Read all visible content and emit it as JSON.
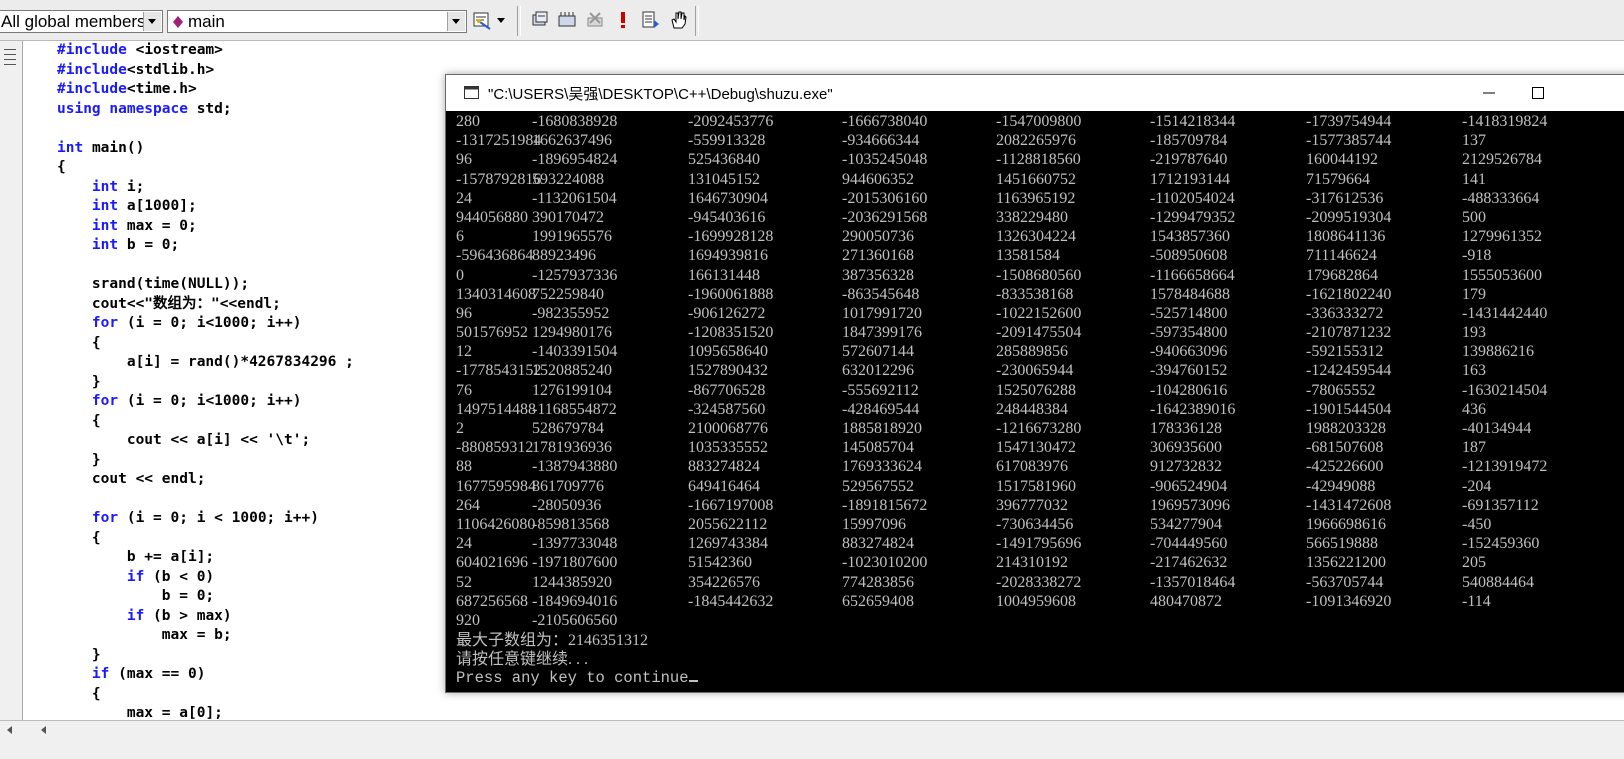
{
  "toolbar": {
    "members_combo": "All global members",
    "function_combo": "main",
    "icons": [
      "diamond-icon",
      "wizard-icon",
      "dropdown-arrow-icon",
      "compile-icon",
      "build-icon",
      "stop-build-icon",
      "execute-icon",
      "go-icon",
      "breakpoint-hand-icon"
    ]
  },
  "editor": {
    "lines": [
      "#include <iostream>",
      "#include<stdlib.h>",
      "#include<time.h>",
      "using namespace std;",
      "",
      "int main()",
      "{",
      "    int i;",
      "    int a[1000];",
      "    int max = 0;",
      "    int b = 0;",
      "",
      "    srand(time(NULL));",
      "    cout<<\"数组为：\"<<endl;",
      "    for (i = 0; i<1000; i++)",
      "    {",
      "        a[i] = rand()*4267834296 ;",
      "    }",
      "    for (i = 0; i<1000; i++)",
      "    {",
      "        cout << a[i] << '\\t';",
      "    }",
      "    cout << endl;",
      "",
      "    for (i = 0; i < 1000; i++)",
      "    {",
      "        b += a[i];",
      "        if (b < 0)",
      "            b = 0;",
      "        if (b > max)",
      "            max = b;",
      "    }",
      "    if (max == 0)",
      "    {",
      "        max = a[0];"
    ],
    "keywords": [
      "#include",
      "using",
      "namespace",
      "int",
      "for",
      "if"
    ]
  },
  "console": {
    "title": "\"C:\\USERS\\吴强\\DESKTOP\\C++\\Debug\\shuzu.exe\"",
    "rows": [
      [
        "280",
        "-1680838928",
        "-2092453776",
        "-1666738040",
        "-1547009800",
        "-1514218344",
        "-1739754944",
        "-1418319824"
      ],
      [
        "-1317251984",
        "1662637496",
        "-559913328",
        "-934666344",
        "2082265976",
        "-185709784",
        "-1577385744",
        "137"
      ],
      [
        "96",
        "-1896954824",
        "525436840",
        "-1035245048",
        "-1128818560",
        "-219787640",
        "160044192",
        "2129526784"
      ],
      [
        "-1578792816",
        "593224088",
        "131045152",
        "944606352",
        "1451660752",
        "1712193144",
        "71579664",
        "141"
      ],
      [
        "24",
        "-1132061504",
        "1646730904",
        "-2015306160",
        "1163965192",
        "-1102054024",
        "-317612536",
        "-488333664"
      ],
      [
        "944056880",
        "390170472",
        "-945403616",
        "-2036291568",
        "338229480",
        "-1299479352",
        "-2099519304",
        "500"
      ],
      [
        "6",
        "1991965576",
        "-1699928128",
        "290050736",
        "1326304224",
        "1543857360",
        "1808641136",
        "1279961352"
      ],
      [
        "-596436864",
        "88923496",
        "1694939816",
        "271360168",
        "13581584",
        "-508950608",
        "711146624",
        "-918"
      ],
      [
        "0",
        "-1257937336",
        "166131448",
        "387356328",
        "-1508680560",
        "-1166658664",
        "179682864",
        "1555053600"
      ],
      [
        "1340314608",
        "752259840",
        "-1960061888",
        "-863545648",
        "-833538168",
        "1578484688",
        "-1621802240",
        "179"
      ],
      [
        "96",
        "-982355952",
        "-906126272",
        "1017991720",
        "-1022152600",
        "-525714800",
        "-336333272",
        "-1431442440"
      ],
      [
        "501576952",
        "1294980176",
        "-1208351520",
        "1847399176",
        "-2091475504",
        "-597354800",
        "-2107871232",
        "193"
      ],
      [
        "12",
        "-1403391504",
        "1095658640",
        "572607144",
        "285889856",
        "-940663096",
        "-592155312",
        "139886216"
      ],
      [
        "-1778543152",
        "1520885240",
        "1527890432",
        "632012296",
        "-230065944",
        "-394760152",
        "-1242459544",
        "163"
      ],
      [
        "76",
        "1276199104",
        "-867706528",
        "-555692112",
        "1525076288",
        "-104280616",
        "-78065552",
        "-1630214504"
      ],
      [
        "1497514488",
        "-1168554872",
        "-324587560",
        "-428469544",
        "248448384",
        "-1642389016",
        "-1901544504",
        "436"
      ],
      [
        "2",
        "528679784",
        "2100068776",
        "1885818920",
        "-1216673280",
        "178336128",
        "1988203328",
        "-40134944"
      ],
      [
        "-880859312",
        "1781936936",
        "1035335552",
        "145085704",
        "1547130472",
        "306935600",
        "-681507608",
        "187"
      ],
      [
        "88",
        "-1387943880",
        "883274824",
        "1769333624",
        "617083976",
        "912732832",
        "-425226600",
        "-1213919472"
      ],
      [
        "1677595984",
        "861709776",
        "649416464",
        "529567552",
        "1517581960",
        "-906524904",
        "-42949088",
        "-204"
      ],
      [
        "264",
        "-28050936",
        "-1667197008",
        "-1891815672",
        "396777032",
        "1969573096",
        "-1431472608",
        "-691357112"
      ],
      [
        "1106426080",
        "-859813568",
        "2055622112",
        "15997096",
        "-730634456",
        "534277904",
        "1966698616",
        "-450"
      ],
      [
        "24",
        "-1397733048",
        "1269743384",
        "883274824",
        "-1491795696",
        "-704449560",
        "566519888",
        "-152459360"
      ],
      [
        "604021696",
        "-1971807600",
        "51542360",
        "-1023010200",
        "214310192",
        "-217462632",
        "1356221200",
        "205"
      ],
      [
        "52",
        "1244385920",
        "354226576",
        "774283856",
        "-2028338272",
        "-1357018464",
        "-563705744",
        "540884464"
      ],
      [
        "687256568",
        "-1849694016",
        "-1845442632",
        "652659408",
        "1004959608",
        "480470872",
        "-1091346920",
        "-114"
      ],
      [
        "920",
        "-2105606560"
      ]
    ],
    "result_line": "最大子数组为：2146351312",
    "pause_line": "请按任意键继续. . .",
    "continue_line": "Press any key to continue"
  }
}
